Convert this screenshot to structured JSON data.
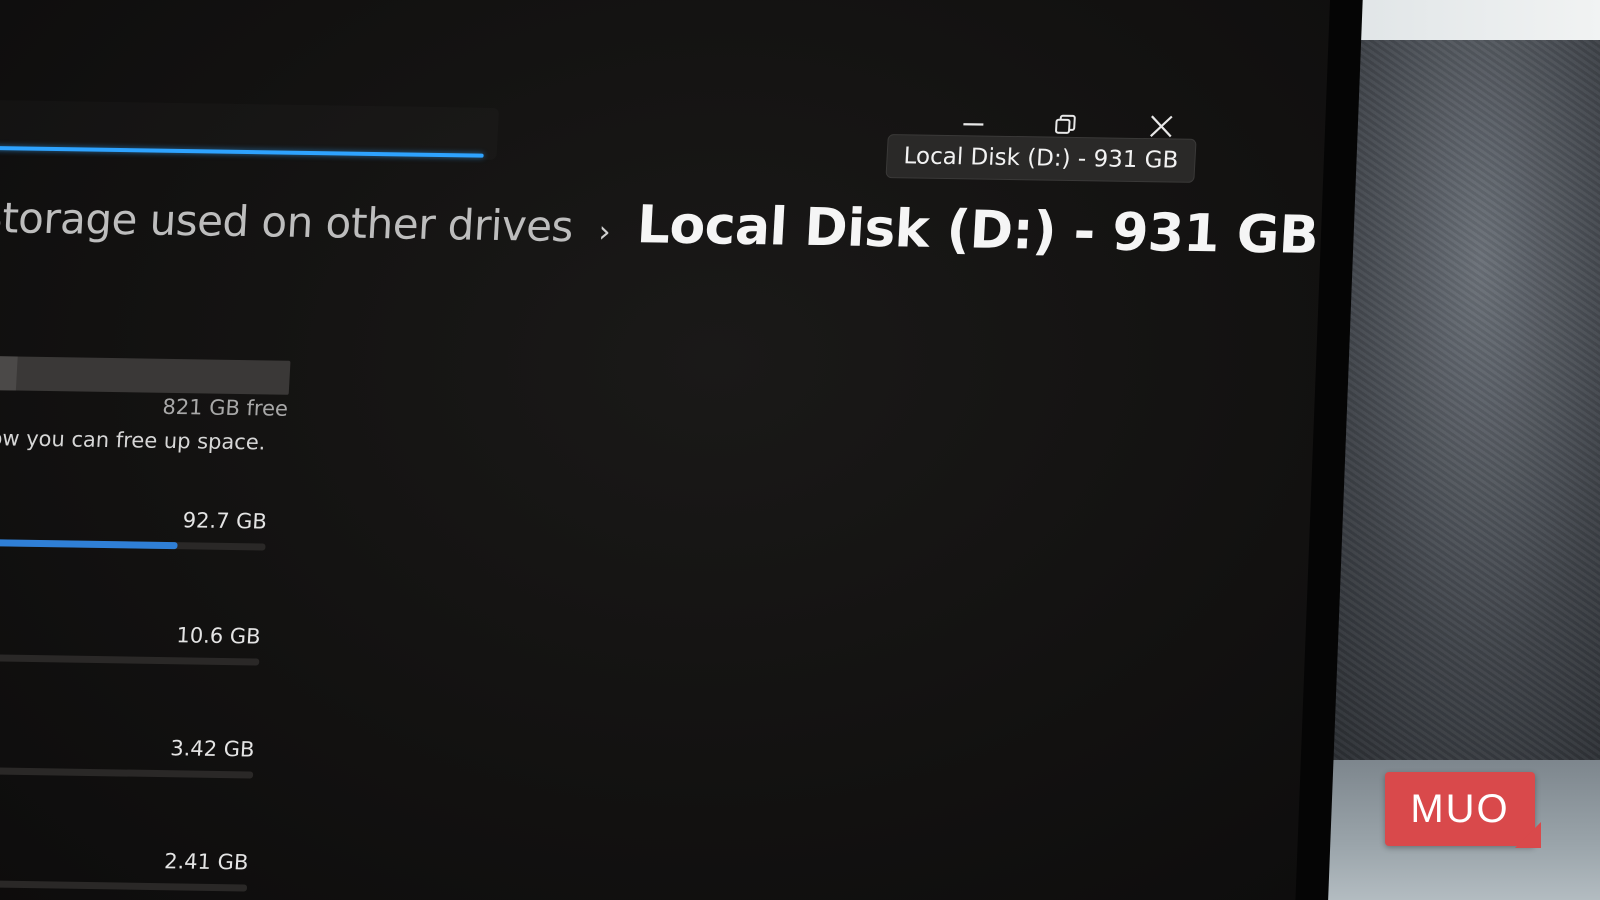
{
  "window": {
    "tooltip": "Local Disk (D:) - 931 GB",
    "controls": {
      "minimize": "minimize-icon",
      "restore": "restore-icon",
      "close": "close-icon"
    }
  },
  "breadcrumb": {
    "parent": "Storage used on other drives",
    "separator": "›",
    "current": "Local Disk (D:) - 931 GB"
  },
  "drive_usage": {
    "free_text": "821 GB free",
    "used_fraction": 0.12,
    "info_text": "how you can free up space."
  },
  "categories": [
    {
      "size": "92.7 GB",
      "fraction": 0.7
    },
    {
      "size": "10.6 GB",
      "fraction": 0.0
    },
    {
      "size": "3.42 GB",
      "fraction": 0.0
    },
    {
      "size": "2.41 GB",
      "fraction": 0.0
    }
  ],
  "watermark": {
    "text": "MUO",
    "color": "#d9494b"
  },
  "colors": {
    "accent": "#2ea3ff",
    "background": "#141312"
  }
}
